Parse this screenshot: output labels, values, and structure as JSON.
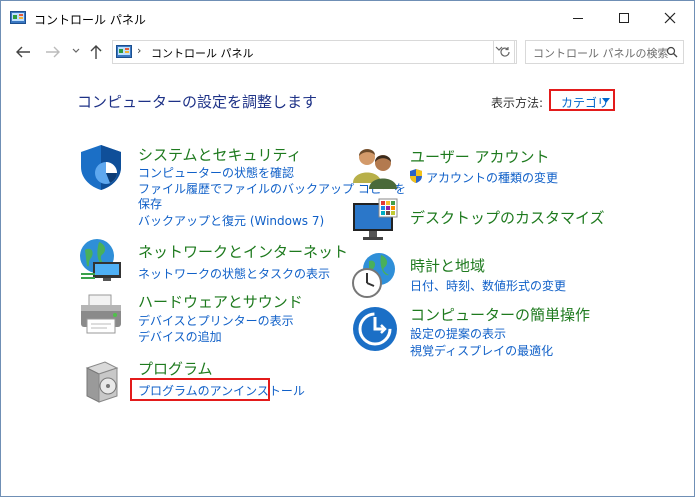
{
  "window": {
    "title": "コントロール パネル"
  },
  "address": {
    "path": "コントロール パネル"
  },
  "search": {
    "placeholder": "コントロール パネルの検索"
  },
  "heading": "コンピューターの設定を調整します",
  "view_by": {
    "label": "表示方法:",
    "value": "カテゴリ"
  },
  "categories": [
    {
      "title": "システムとセキュリティ",
      "links": [
        "コンピューターの状態を確認",
        "ファイル履歴でファイルのバックアップ コピーを",
        "保存",
        "バックアップと復元 (Windows 7)"
      ]
    },
    {
      "title": "ネットワークとインターネット",
      "links": [
        "ネットワークの状態とタスクの表示"
      ]
    },
    {
      "title": "ハードウェアとサウンド",
      "links": [
        "デバイスとプリンターの表示",
        "デバイスの追加"
      ]
    },
    {
      "title": "プログラム",
      "links": [
        "プログラムのアンインストール"
      ]
    },
    {
      "title": "ユーザー アカウント",
      "links": [
        "アカウントの種類の変更"
      ]
    },
    {
      "title": "デスクトップのカスタマイズ",
      "links": []
    },
    {
      "title": "時計と地域",
      "links": [
        "日付、時刻、数値形式の変更"
      ]
    },
    {
      "title": "コンピューターの簡単操作",
      "links": [
        "設定の提案の表示",
        "視覚ディスプレイの最適化"
      ]
    }
  ],
  "colors": {
    "heading": "#1e3287",
    "category": "#1e7a1e",
    "link": "#1060c8",
    "highlight": "#e31b1b"
  }
}
